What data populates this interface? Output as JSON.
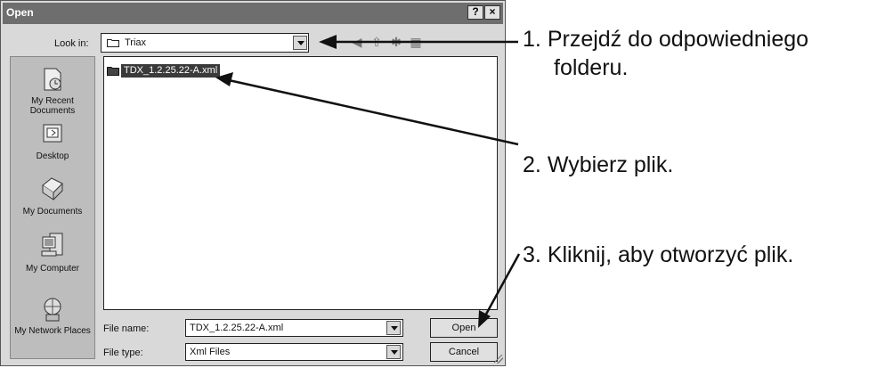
{
  "dialog": {
    "title": "Open",
    "help_button": "?",
    "close_button": "×"
  },
  "lookin": {
    "label": "Look in:",
    "value": "Triax"
  },
  "places": [
    {
      "label": "My Recent Documents"
    },
    {
      "label": "Desktop"
    },
    {
      "label": "My Documents"
    },
    {
      "label": "My Computer"
    },
    {
      "label": "My Network Places"
    }
  ],
  "files": [
    {
      "name": "TDX_1.2.25.22-A.xml"
    }
  ],
  "filename": {
    "label": "File name:",
    "value": "TDX_1.2.25.22-A.xml"
  },
  "filetype": {
    "label": "File type:",
    "value": "Xml Files"
  },
  "buttons": {
    "open": "Open",
    "cancel": "Cancel"
  },
  "annotations": [
    {
      "number": "1.",
      "text": "Przejdź do odpowiedniego",
      "text2": "folderu."
    },
    {
      "number": "2.",
      "text": "Wybierz plik."
    },
    {
      "number": "3.",
      "text": "Kliknij, aby otworzyć plik."
    }
  ],
  "icons": {
    "folder": "folder-icon",
    "back": "back-icon",
    "up": "up-folder-icon",
    "new_folder": "new-folder-icon",
    "views": "views-menu-icon"
  }
}
